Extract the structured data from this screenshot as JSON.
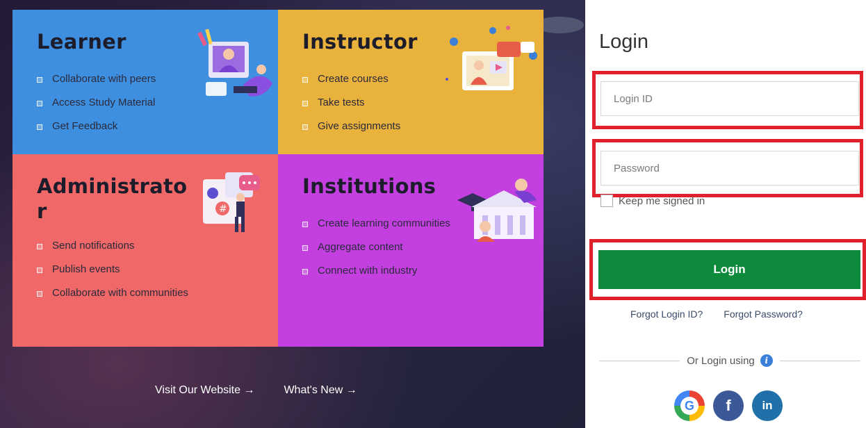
{
  "cards": {
    "learner": {
      "title": "Learner",
      "items": [
        "Collaborate with peers",
        "Access Study Material",
        "Get Feedback"
      ]
    },
    "instructor": {
      "title": "Instructor",
      "items": [
        "Create courses",
        "Take tests",
        "Give assignments"
      ]
    },
    "administrator": {
      "title": "Administrator",
      "items": [
        "Send notifications",
        "Publish events",
        "Collaborate with communities"
      ]
    },
    "institutions": {
      "title": "Institutions",
      "items": [
        "Create learning communities",
        "Aggregate content",
        "Connect with industry"
      ]
    }
  },
  "footer": {
    "visit": "Visit Our Website →",
    "whats_new": "What's New →"
  },
  "login": {
    "title": "Login",
    "login_id_placeholder": "Login ID",
    "password_placeholder": "Password",
    "keep_signed_in": "Keep me signed in",
    "button": "Login",
    "forgot_login_id": "Forgot Login ID?",
    "forgot_password": "Forgot Password?",
    "or_login_using": "Or Login using",
    "info_glyph": "i",
    "social": {
      "google": "G",
      "facebook": "f",
      "linkedin": "in"
    }
  },
  "colors": {
    "learner": "#3f8fe0",
    "instructor": "#e9b23c",
    "administrator": "#f06868",
    "institutions": "#c33fe0",
    "login_button": "#0d8a3c",
    "highlight": "#e0202a"
  },
  "icons": [
    "learner-illustration",
    "instructor-illustration",
    "administrator-illustration",
    "institutions-illustration",
    "info-icon",
    "google-icon",
    "facebook-icon",
    "linkedin-icon",
    "arrow-right-icon"
  ]
}
